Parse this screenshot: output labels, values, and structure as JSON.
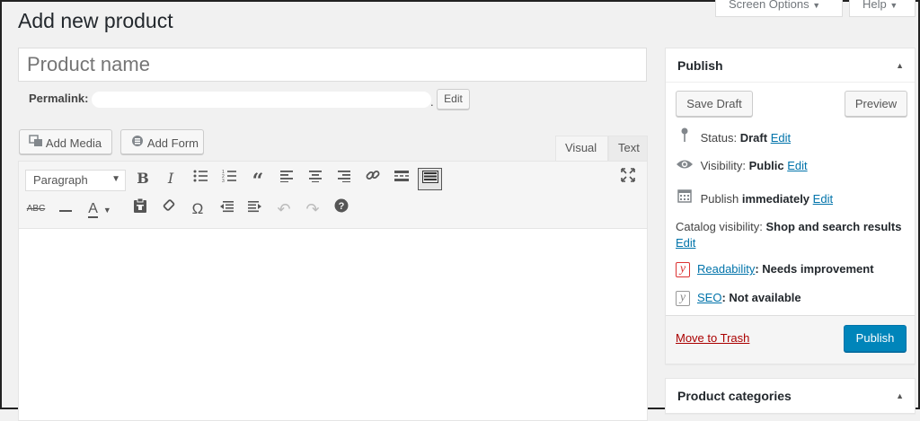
{
  "header": {
    "title": "Add new product",
    "screen_options": "Screen Options",
    "help": "Help"
  },
  "product": {
    "name_placeholder": "Product name",
    "permalink_label": "Permalink:",
    "permalink_edit": "Edit"
  },
  "editor": {
    "add_media": "Add Media",
    "add_form": "Add Form",
    "tab_visual": "Visual",
    "tab_text": "Text",
    "format_select": "Paragraph",
    "toolbar_row1": [
      "bold",
      "italic",
      "bullet-list",
      "numbered-list",
      "blockquote",
      "align-left",
      "align-center",
      "align-right",
      "insert-link",
      "read-more",
      "toolbar-toggle",
      "fullscreen"
    ],
    "toolbar_row2": [
      "strikethrough",
      "horizontal-line",
      "text-color",
      "paste-as-text",
      "clear-formatting",
      "special-character",
      "outdent",
      "indent",
      "undo",
      "redo",
      "keyboard-shortcuts"
    ]
  },
  "publish_box": {
    "title": "Publish",
    "save_draft": "Save Draft",
    "preview": "Preview",
    "status_label": "Status:",
    "status_value": "Draft",
    "status_edit": "Edit",
    "visibility_label": "Visibility:",
    "visibility_value": "Public",
    "visibility_edit": "Edit",
    "publish_label": "Publish",
    "publish_value": "immediately",
    "publish_edit": "Edit",
    "catalog_label": "Catalog visibility:",
    "catalog_value": "Shop and search results",
    "catalog_edit": "Edit",
    "readability_link": "Readability",
    "readability_value": ": Needs improvement",
    "seo_link": "SEO",
    "seo_value": ": Not available",
    "move_to_trash": "Move to Trash",
    "publish_button": "Publish"
  },
  "categories_box": {
    "title": "Product categories"
  },
  "colors": {
    "primary": "#0085ba",
    "link": "#0073aa",
    "trash": "#a00000",
    "readability_status": "#dc3232"
  }
}
